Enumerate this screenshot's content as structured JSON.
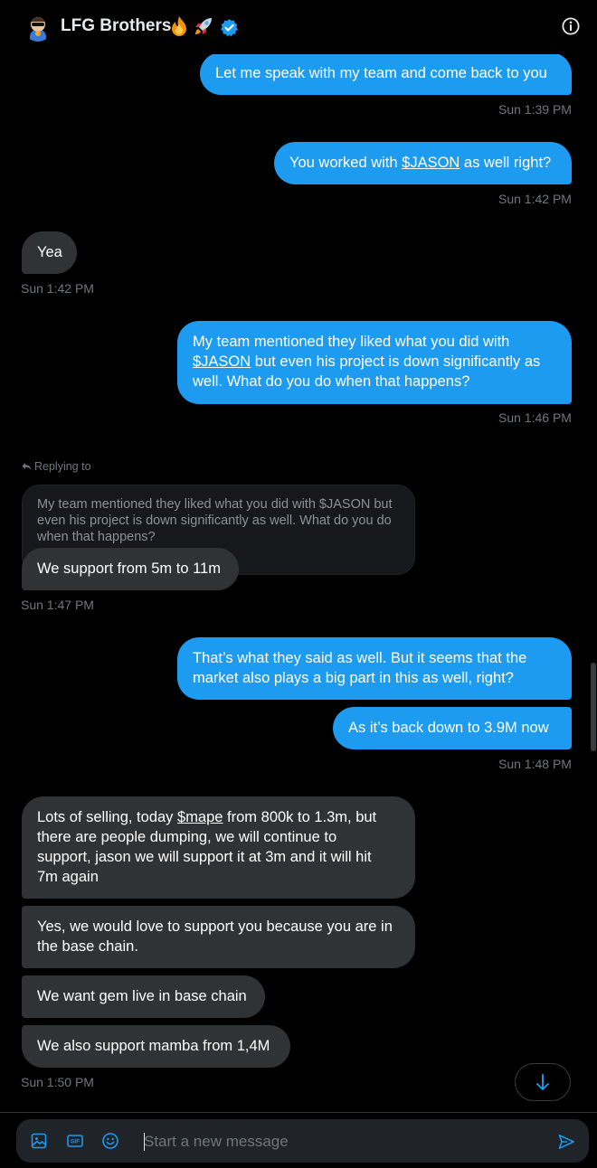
{
  "header": {
    "name": "LFG Brothers",
    "title_emoji_1": "🔥",
    "title_emoji_2": "🚀",
    "verified_icon": "verified-badge-icon",
    "info_icon": "info-icon",
    "accent_color": "#1d9bf0"
  },
  "messages": [
    {
      "side": "sent",
      "text": "Let me speak with my team and come back to you",
      "time": "Sun 1:39 PM"
    },
    {
      "side": "sent",
      "text_before": "You worked with ",
      "link": "$JASON",
      "text_after": " as well right?",
      "time": "Sun 1:42 PM"
    },
    {
      "side": "received",
      "text": "Yea",
      "time": "Sun 1:42 PM"
    },
    {
      "side": "sent",
      "line1": "My team mentioned they liked what you did with",
      "link": "$JASON",
      "line2_after": " but even his project is down significantly as",
      "line3": "well. What do you do when that happens?",
      "time": "Sun 1:46 PM"
    },
    {
      "side": "received",
      "reply_label": "Replying to",
      "quote_line1": "My team mentioned they liked what you did with $JASON but",
      "quote_line2": "even his project is down significantly as well. What do you do",
      "quote_line3": "when that happens?",
      "text": "We support from 5m to 11m",
      "time": "Sun 1:47 PM"
    },
    {
      "side": "sent",
      "line1": "That’s what they said as well. But it seems that the",
      "line2": "market also plays a big part in this as well, right?"
    },
    {
      "side": "sent",
      "text": "As it’s back down to 3.9M now",
      "time": "Sun 1:48 PM"
    },
    {
      "side": "received",
      "line1_before": "Lots of selling, today ",
      "link": "$mape",
      "line1_after": " from 800k to 1.3m, but",
      "line2": "there are people dumping, we will continue to",
      "line3": "support, jason we will support it at 3m and it will hit",
      "line4": "7m again"
    },
    {
      "side": "received",
      "line1": "Yes, we would love to support you because you are in",
      "line2": "the base chain."
    },
    {
      "side": "received",
      "text": "We want gem live in base chain"
    },
    {
      "side": "received",
      "text": "We also support mamba from 1,4M",
      "time": "Sun 1:50 PM"
    }
  ],
  "composer": {
    "placeholder": "Start a new message",
    "value": "",
    "media_icon": "image-icon",
    "gif_icon": "gif-icon",
    "gif_label": "GIF",
    "emoji_icon": "emoji-icon",
    "send_icon": "send-icon"
  },
  "scroll_down_icon": "arrow-down-icon"
}
